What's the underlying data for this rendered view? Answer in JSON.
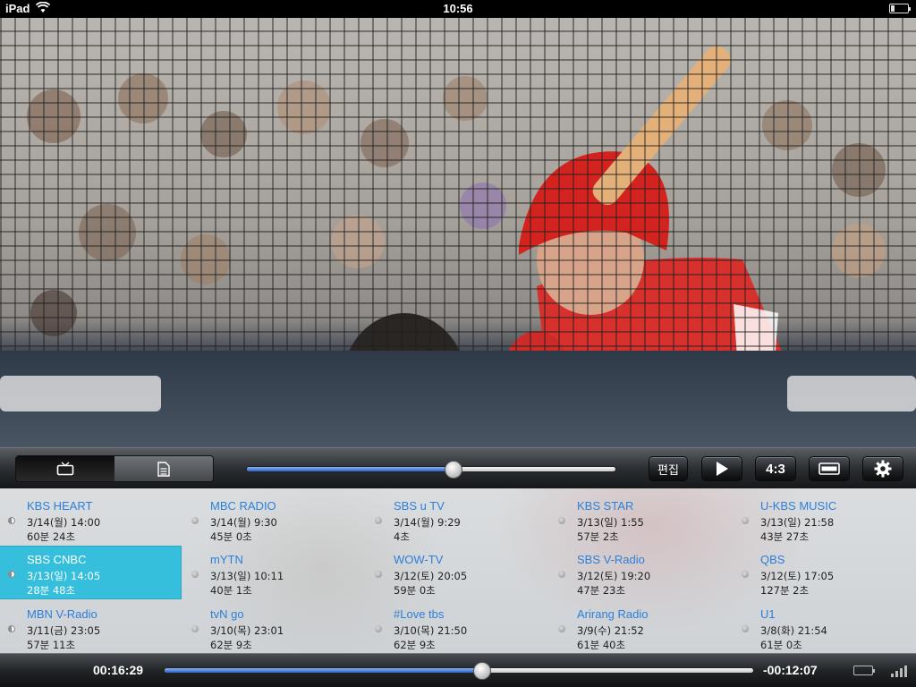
{
  "status": {
    "carrier": "iPad",
    "clock": "10:56"
  },
  "controls": {
    "edit_label": "편집",
    "aspect_label": "4:3",
    "seek_progress": 0.56
  },
  "channels": [
    {
      "name": "KBS HEART",
      "when": "3/14(월) 14:00",
      "dur": "60분 24초",
      "dot": "half"
    },
    {
      "name": "MBC RADIO",
      "when": "3/14(월) 9:30",
      "dur": "45분 0초",
      "dot": "full"
    },
    {
      "name": "SBS u TV",
      "when": "3/14(월) 9:29",
      "dur": "4초",
      "dot": "full"
    },
    {
      "name": "KBS STAR",
      "when": "3/13(일) 1:55",
      "dur": "57분 2초",
      "dot": "full"
    },
    {
      "name": "U-KBS MUSIC",
      "when": "3/13(일) 21:58",
      "dur": "43분 27초",
      "dot": "full"
    },
    {
      "name": "SBS CNBC",
      "when": "3/13(일) 14:05",
      "dur": "28분 48초",
      "dot": "half",
      "selected": true
    },
    {
      "name": "mYTN",
      "when": "3/13(일) 10:11",
      "dur": "40분 1초",
      "dot": "full"
    },
    {
      "name": "WOW-TV",
      "when": "3/12(토) 20:05",
      "dur": "59분 0초",
      "dot": "full"
    },
    {
      "name": "SBS V-Radio",
      "when": "3/12(토) 19:20",
      "dur": "47분 23초",
      "dot": "full"
    },
    {
      "name": "QBS",
      "when": "3/12(토) 17:05",
      "dur": "127분 2초",
      "dot": "full"
    },
    {
      "name": "MBN V-Radio",
      "when": "3/11(금) 23:05",
      "dur": "57분 11초",
      "dot": "half"
    },
    {
      "name": "tvN go",
      "when": "3/10(목) 23:01",
      "dur": "62분 9초",
      "dot": "full"
    },
    {
      "name": "#Love tbs",
      "when": "3/10(목) 21:50",
      "dur": "62분 9초",
      "dot": "full"
    },
    {
      "name": "Arirang Radio",
      "when": "3/9(수) 21:52",
      "dur": "61분 40초",
      "dot": "full"
    },
    {
      "name": "U1",
      "when": "3/8(화) 21:54",
      "dur": "61분 0초",
      "dot": "full"
    }
  ],
  "playback": {
    "elapsed": "00:16:29",
    "remaining": "-00:12:07",
    "progress": 0.54
  }
}
